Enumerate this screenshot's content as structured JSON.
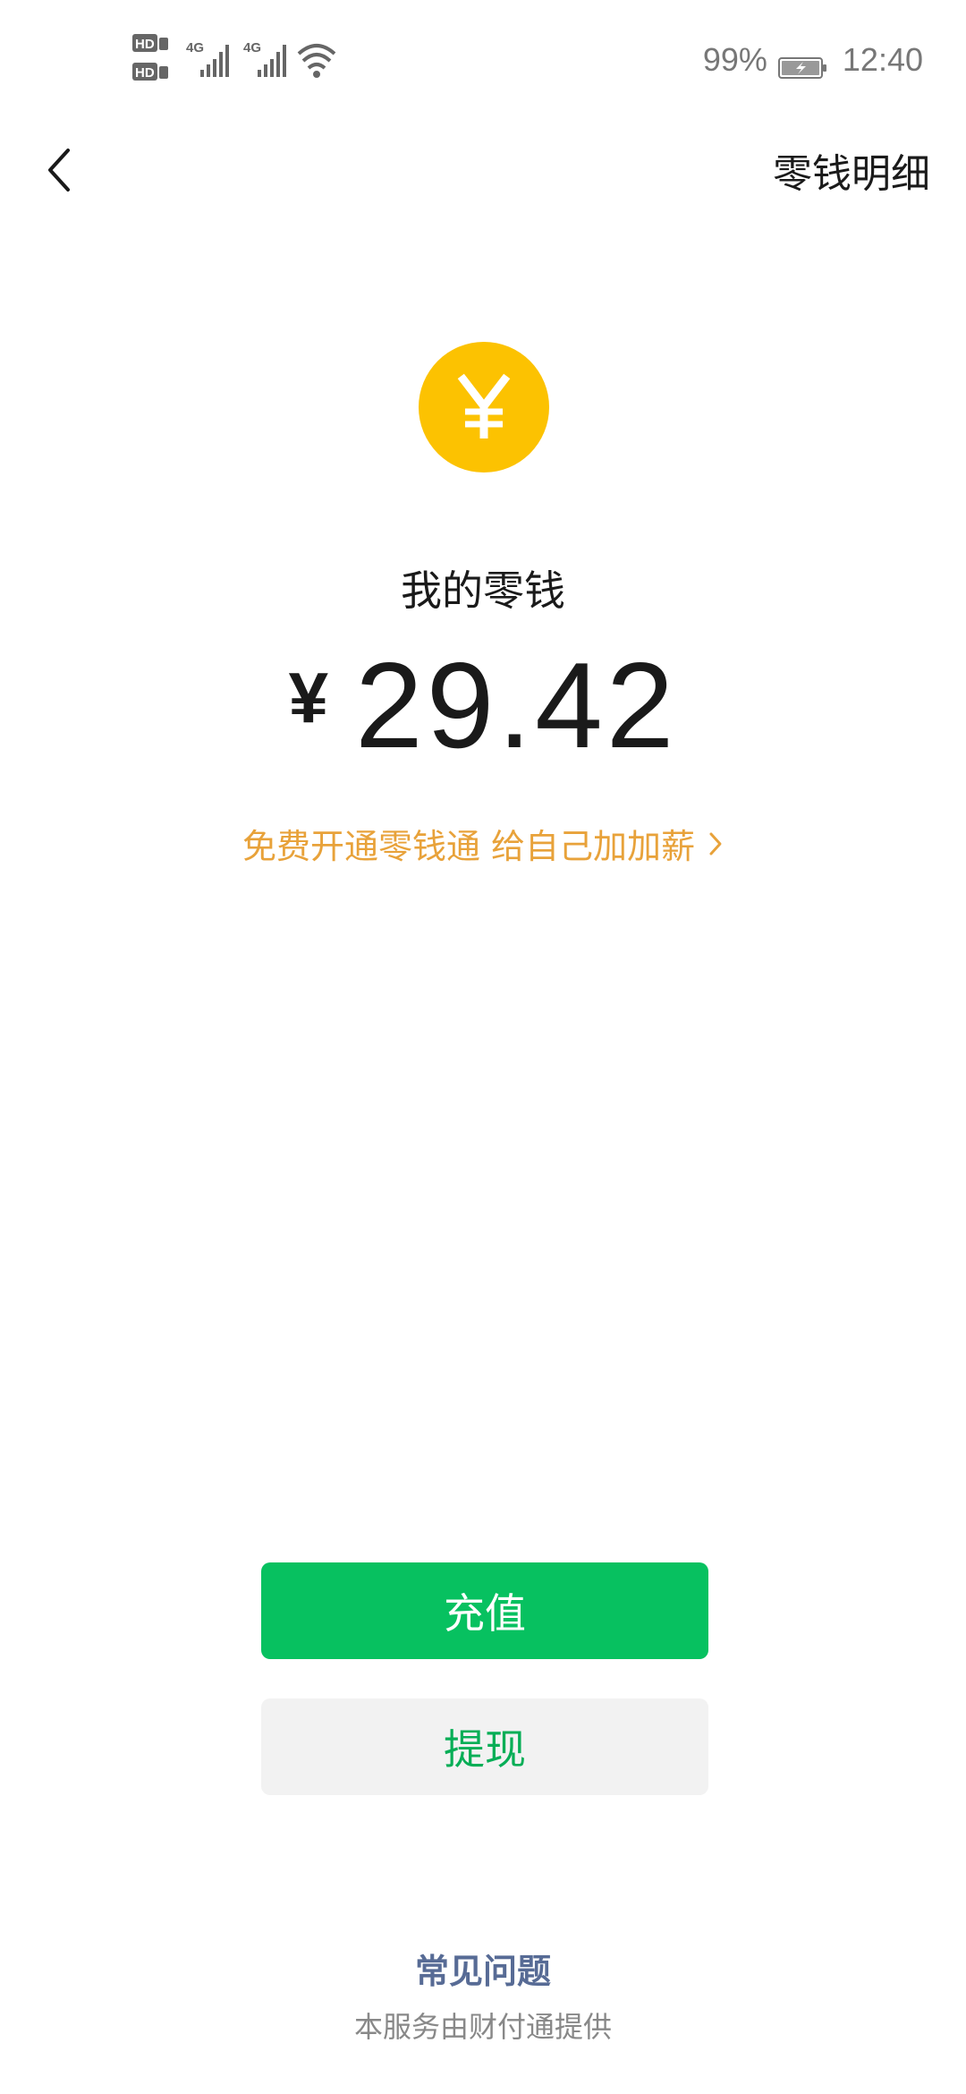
{
  "status_bar": {
    "sim1": "HD1",
    "sim2": "HD2",
    "network1": "4G",
    "network2": "4G",
    "battery_percent": "99%",
    "time": "12:40",
    "icons": [
      "hd-sim-icon",
      "signal-4g-icon",
      "signal-4g-icon",
      "wifi-icon",
      "battery-charging-icon"
    ]
  },
  "nav": {
    "back_icon": "chevron-left-icon",
    "detail_label": "零钱明细"
  },
  "wallet": {
    "coin_icon": "yuan-coin-icon",
    "coin_color": "#fcc201",
    "label": "我的零钱",
    "currency_symbol": "¥",
    "balance": "29.42",
    "promo_text": "免费开通零钱通 给自己加加薪",
    "promo_color": "#e8a23a"
  },
  "actions": {
    "topup_label": "充值",
    "withdraw_label": "提现",
    "primary_color": "#07c160"
  },
  "footer": {
    "faq_label": "常见问题",
    "provider_text": "本服务由财付通提供"
  }
}
